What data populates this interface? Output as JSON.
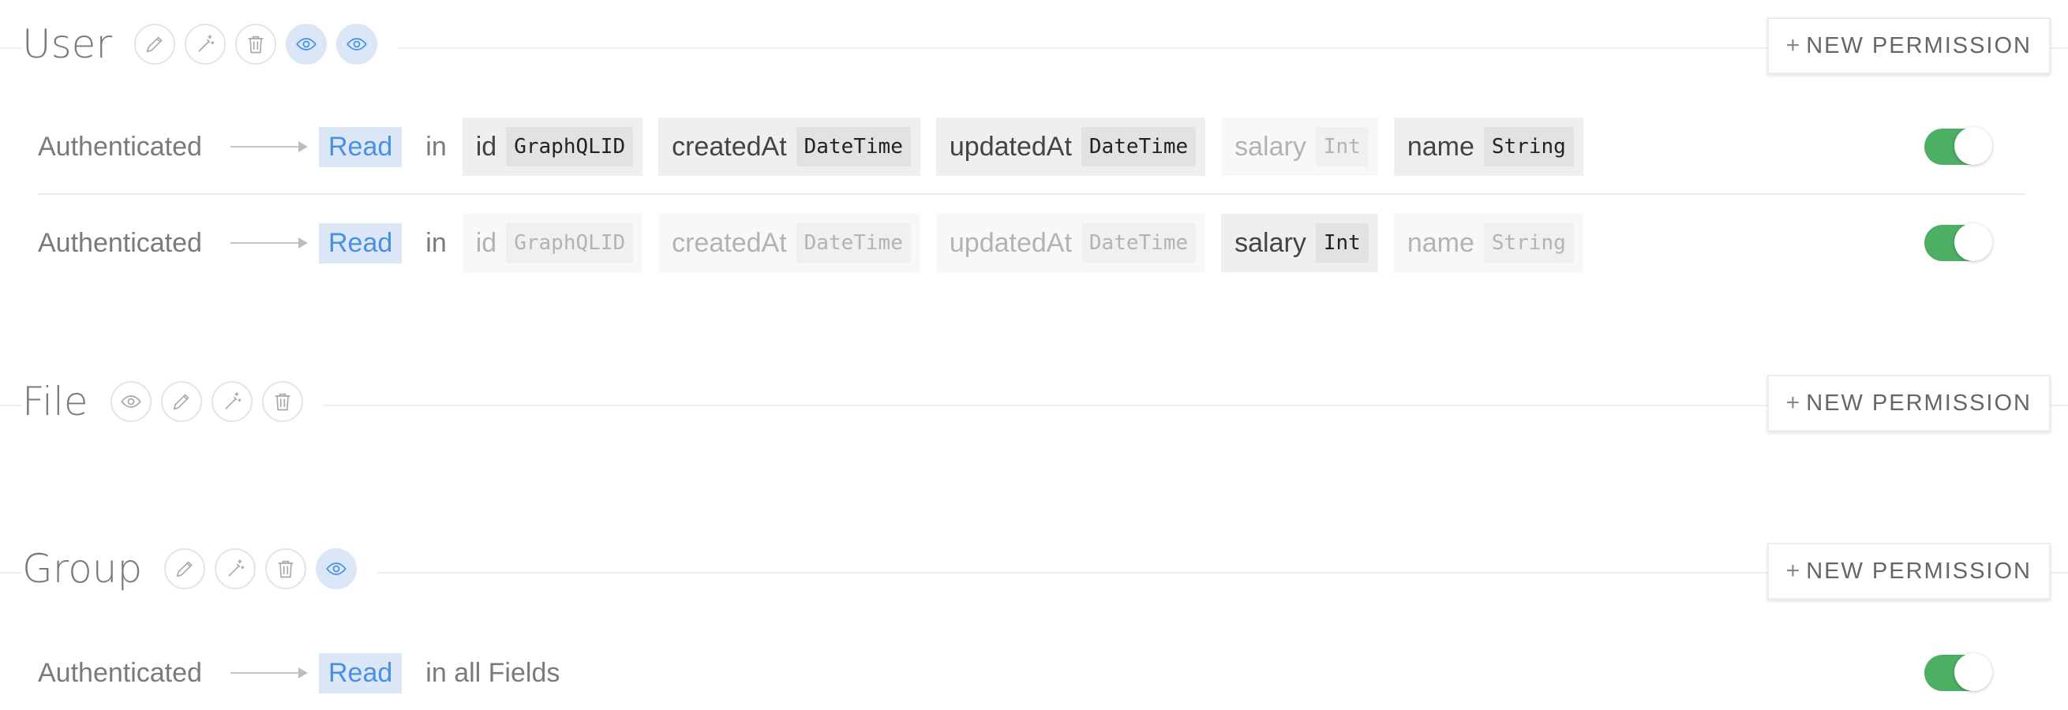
{
  "new_permission_label": "NEW PERMISSION",
  "colors": {
    "accent": "#4a90e2",
    "toggle_on": "#4caf64"
  },
  "sections": {
    "user": {
      "title": "User",
      "icons": [
        "pencil-icon",
        "magic-wand-icon",
        "trash-icon",
        "eye-icon",
        "eye-icon"
      ],
      "rows": [
        {
          "role": "Authenticated",
          "operation": "Read",
          "in_label": "in",
          "fields": [
            {
              "name": "id",
              "type": "GraphQLID",
              "enabled": true
            },
            {
              "name": "createdAt",
              "type": "DateTime",
              "enabled": true
            },
            {
              "name": "updatedAt",
              "type": "DateTime",
              "enabled": true
            },
            {
              "name": "salary",
              "type": "Int",
              "enabled": false
            },
            {
              "name": "name",
              "type": "String",
              "enabled": true
            }
          ],
          "active": true
        },
        {
          "role": "Authenticated",
          "operation": "Read",
          "in_label": "in",
          "fields": [
            {
              "name": "id",
              "type": "GraphQLID",
              "enabled": false
            },
            {
              "name": "createdAt",
              "type": "DateTime",
              "enabled": false
            },
            {
              "name": "updatedAt",
              "type": "DateTime",
              "enabled": false
            },
            {
              "name": "salary",
              "type": "Int",
              "enabled": true
            },
            {
              "name": "name",
              "type": "String",
              "enabled": false
            }
          ],
          "active": true
        }
      ]
    },
    "file": {
      "title": "File",
      "icons": [
        "eye-icon",
        "pencil-icon",
        "magic-wand-icon",
        "trash-icon"
      ]
    },
    "group": {
      "title": "Group",
      "icons": [
        "pencil-icon",
        "magic-wand-icon",
        "trash-icon",
        "eye-icon"
      ],
      "rows": [
        {
          "role": "Authenticated",
          "operation": "Read",
          "scope": "in all Fields",
          "active": true
        }
      ]
    }
  }
}
